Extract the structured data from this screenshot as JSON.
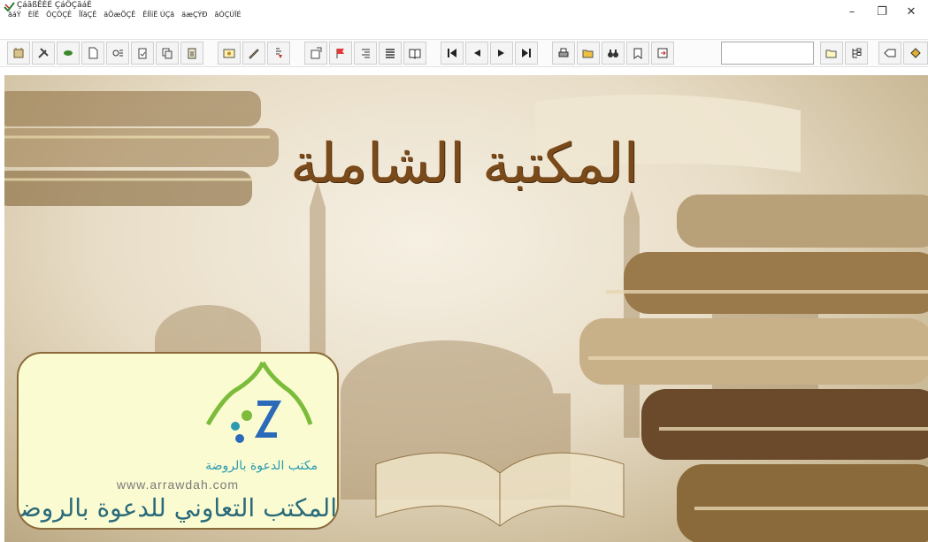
{
  "window": {
    "title": "ÇáãßÊÈÉ ÇáÔÇãáÉ",
    "controls": {
      "minimize": "–",
      "maximize": "❐",
      "close": "✕"
    }
  },
  "menubar": {
    "items": [
      {
        "label": "ãáÝ"
      },
      {
        "label": "ÈÍË"
      },
      {
        "label": "ÔÇÔÇÊ"
      },
      {
        "label": "ÎÏãÇÊ"
      },
      {
        "label": "äÕæÕÇÊ"
      },
      {
        "label": "ÊÍÏíË ÚÇã"
      },
      {
        "label": "äæÇÝÐ"
      },
      {
        "label": "ãÓÇÚÏÉ"
      }
    ]
  },
  "toolbar": {
    "buttons": [
      {
        "icon": "library-icon"
      },
      {
        "icon": "tools-icon"
      },
      {
        "icon": "leaf-icon"
      },
      {
        "icon": "new-page-icon"
      },
      {
        "icon": "search-text-icon"
      },
      {
        "icon": "clipboard-check-icon"
      },
      {
        "icon": "copy-icon"
      },
      {
        "icon": "paste-icon"
      },
      {
        "icon": "image-icon"
      },
      {
        "icon": "pencil-icon"
      },
      {
        "icon": "index-icon"
      },
      {
        "icon": "properties-icon"
      },
      {
        "icon": "red-flag-icon"
      },
      {
        "icon": "align-right-icon"
      },
      {
        "icon": "align-justify-icon"
      },
      {
        "icon": "book-open-icon"
      },
      {
        "icon": "first-page-icon"
      },
      {
        "icon": "previous-page-icon"
      },
      {
        "icon": "next-page-icon"
      },
      {
        "icon": "last-page-icon"
      },
      {
        "icon": "print-icon"
      },
      {
        "icon": "open-folder-icon"
      },
      {
        "icon": "binoculars-icon"
      },
      {
        "icon": "bookmark-icon"
      },
      {
        "icon": "export-icon"
      },
      {
        "icon": "open-file-icon"
      },
      {
        "icon": "tree-icon"
      },
      {
        "icon": "tag-icon"
      },
      {
        "icon": "highlighter-icon"
      }
    ],
    "search_value": ""
  },
  "banner": {
    "title_text": "المكتبة الشاملة"
  },
  "logo": {
    "arabic_name": "مكتب الدعوة بالروضة",
    "url": "www.arrawdah.com",
    "calligraphy": "المكتب التعاوني للدعوة بالروضة",
    "colors": {
      "green": "#7cbc3a",
      "teal": "#2a9ab0",
      "blue": "#2a6ab8"
    }
  }
}
